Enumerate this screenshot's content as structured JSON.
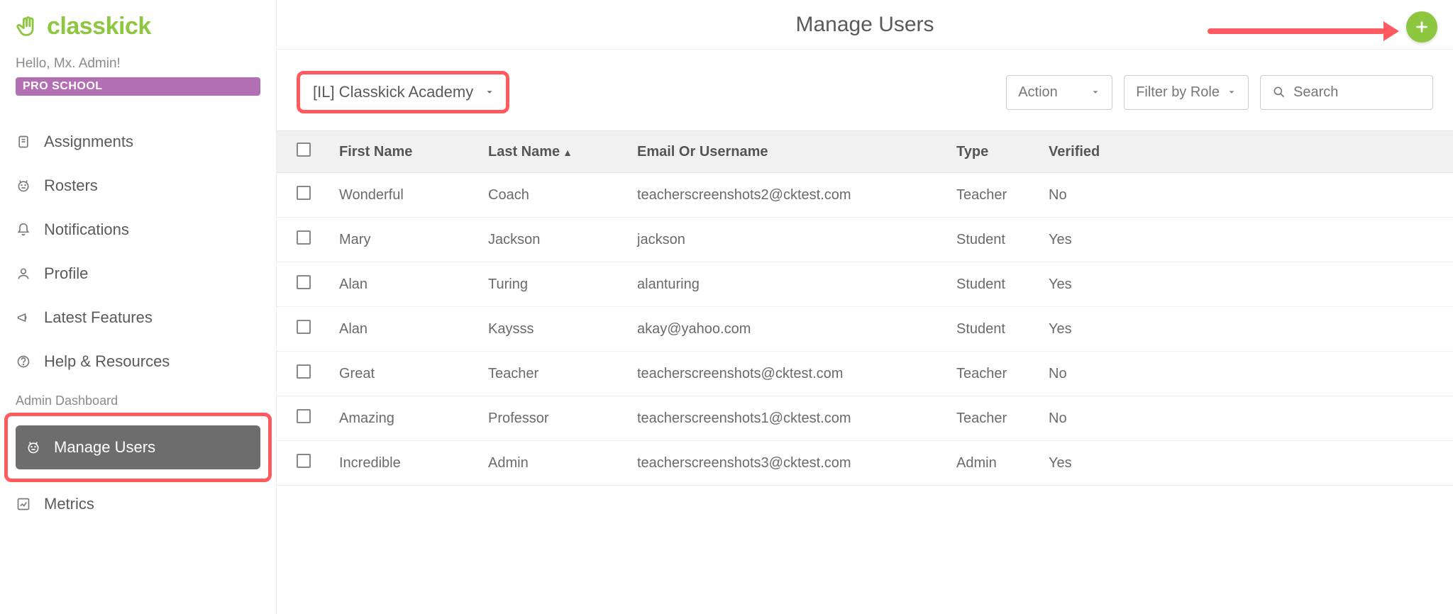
{
  "brand": {
    "name": "classkick"
  },
  "greeting": "Hello, Mx. Admin!",
  "badge": "PRO SCHOOL",
  "sidebar": {
    "items": [
      {
        "label": "Assignments",
        "icon": "document-icon"
      },
      {
        "label": "Rosters",
        "icon": "smiley-icon"
      },
      {
        "label": "Notifications",
        "icon": "bell-icon"
      },
      {
        "label": "Profile",
        "icon": "person-icon"
      },
      {
        "label": "Latest Features",
        "icon": "megaphone-icon"
      },
      {
        "label": "Help & Resources",
        "icon": "help-icon"
      }
    ],
    "admin_label": "Admin Dashboard",
    "admin_items": [
      {
        "label": "Manage Users",
        "icon": "smiley-icon",
        "active": true
      },
      {
        "label": "Metrics",
        "icon": "chart-icon"
      }
    ]
  },
  "header": {
    "title": "Manage Users"
  },
  "controls": {
    "school_selected": "[IL] Classkick Academy",
    "action_label": "Action",
    "filter_label": "Filter by Role",
    "search_placeholder": "Search"
  },
  "table": {
    "columns": {
      "first": "First Name",
      "last": "Last Name",
      "email": "Email Or Username",
      "type": "Type",
      "verified": "Verified"
    },
    "rows": [
      {
        "first": "Wonderful",
        "last": "Coach",
        "email": "teacherscreenshots2@cktest.com",
        "type": "Teacher",
        "verified": "No"
      },
      {
        "first": "Mary",
        "last": "Jackson",
        "email": "jackson",
        "type": "Student",
        "verified": "Yes"
      },
      {
        "first": "Alan",
        "last": "Turing",
        "email": "alanturing",
        "type": "Student",
        "verified": "Yes"
      },
      {
        "first": "Alan",
        "last": "Kaysss",
        "email": "akay@yahoo.com",
        "type": "Student",
        "verified": "Yes"
      },
      {
        "first": "Great",
        "last": "Teacher",
        "email": "teacherscreenshots@cktest.com",
        "type": "Teacher",
        "verified": "No"
      },
      {
        "first": "Amazing",
        "last": "Professor",
        "email": "teacherscreenshots1@cktest.com",
        "type": "Teacher",
        "verified": "No"
      },
      {
        "first": "Incredible",
        "last": "Admin",
        "email": "teacherscreenshots3@cktest.com",
        "type": "Admin",
        "verified": "Yes"
      }
    ]
  }
}
